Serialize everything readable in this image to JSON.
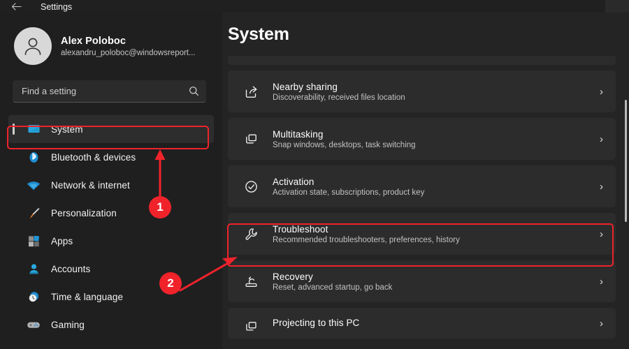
{
  "titlebar": {
    "back_icon": "back-arrow-icon",
    "title": "Settings"
  },
  "sidebar": {
    "account": {
      "avatar_icon": "user-avatar-icon",
      "name": "Alex Poloboc",
      "email": "alexandru_poloboc@windowsreport..."
    },
    "search": {
      "placeholder": "Find a setting",
      "value": "",
      "icon": "search-icon"
    },
    "items": [
      {
        "label": "System",
        "icon": "monitor-icon",
        "selected": true
      },
      {
        "label": "Bluetooth & devices",
        "icon": "bluetooth-icon",
        "selected": false
      },
      {
        "label": "Network & internet",
        "icon": "wifi-icon",
        "selected": false
      },
      {
        "label": "Personalization",
        "icon": "paintbrush-icon",
        "selected": false
      },
      {
        "label": "Apps",
        "icon": "apps-icon",
        "selected": false
      },
      {
        "label": "Accounts",
        "icon": "person-icon",
        "selected": false
      },
      {
        "label": "Time & language",
        "icon": "clock-icon",
        "selected": false
      },
      {
        "label": "Gaming",
        "icon": "gamepad-icon",
        "selected": false
      }
    ]
  },
  "main": {
    "title": "System",
    "rows": [
      {
        "title": "Nearby sharing",
        "subtitle": "Discoverability, received files location",
        "icon": "share-icon",
        "chevron": "›"
      },
      {
        "title": "Multitasking",
        "subtitle": "Snap windows, desktops, task switching",
        "icon": "multitasking-windows-icon",
        "chevron": "›"
      },
      {
        "title": "Activation",
        "subtitle": "Activation state, subscriptions, product key",
        "icon": "check-circle-icon",
        "chevron": "›"
      },
      {
        "title": "Troubleshoot",
        "subtitle": "Recommended troubleshooters, preferences, history",
        "icon": "wrench-icon",
        "chevron": "›",
        "highlighted": true
      },
      {
        "title": "Recovery",
        "subtitle": "Reset, advanced startup, go back",
        "icon": "recovery-icon",
        "chevron": "›"
      },
      {
        "title": "Projecting to this PC",
        "subtitle": "",
        "icon": "projecting-icon",
        "chevron": "›"
      }
    ]
  },
  "annotations": {
    "color": "#f0232b",
    "markers": [
      {
        "label": "1",
        "points_to": "System"
      },
      {
        "label": "2",
        "points_to": "Troubleshoot"
      }
    ]
  }
}
